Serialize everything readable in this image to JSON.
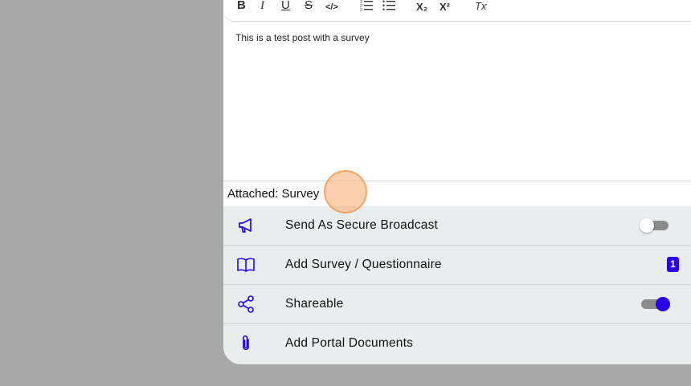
{
  "toolbar": {
    "bold": "B",
    "italic": "I",
    "underline": "U",
    "strike": "S",
    "code": "</>",
    "subscript": "X₂",
    "superscript": "X²",
    "clear": "Tx"
  },
  "editor": {
    "content": "This is a test post with a survey"
  },
  "attached": {
    "label": "Attached: Survey"
  },
  "options": [
    {
      "label": "Send As Secure Broadcast",
      "icon": "megaphone-icon",
      "toggle": "off"
    },
    {
      "label": "Add Survey / Questionnaire",
      "icon": "book-icon",
      "badge": "1"
    },
    {
      "label": "Shareable",
      "icon": "share-icon",
      "toggle": "on"
    },
    {
      "label": "Add Portal Documents",
      "icon": "paperclip-icon"
    }
  ],
  "colors": {
    "accent": "#2a00e8",
    "option_bg": "#eaedee",
    "page_bg": "#a8a8a8"
  }
}
